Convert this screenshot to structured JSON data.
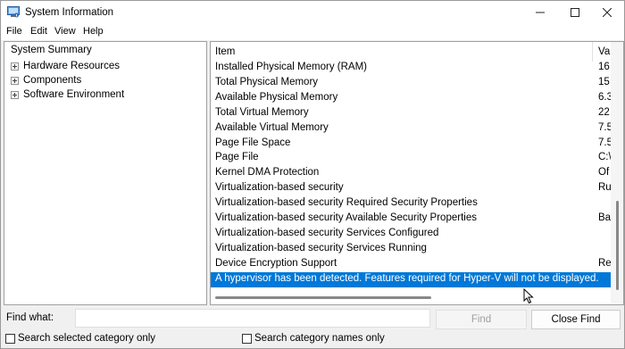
{
  "window": {
    "title": "System Information",
    "icon": "system-information-icon"
  },
  "menu": [
    "File",
    "Edit",
    "View",
    "Help"
  ],
  "tree": {
    "root": "System Summary",
    "children": [
      "Hardware Resources",
      "Components",
      "Software Environment"
    ]
  },
  "table": {
    "columns": {
      "item": "Item",
      "value": "Va"
    },
    "rows": [
      {
        "item": "Installed Physical Memory (RAM)",
        "value": "16"
      },
      {
        "item": "Total Physical Memory",
        "value": "15"
      },
      {
        "item": "Available Physical Memory",
        "value": "6.3"
      },
      {
        "item": "Total Virtual Memory",
        "value": "22"
      },
      {
        "item": "Available Virtual Memory",
        "value": "7.5"
      },
      {
        "item": "Page File Space",
        "value": "7.5"
      },
      {
        "item": "Page File",
        "value": "C:\\"
      },
      {
        "item": "Kernel DMA Protection",
        "value": "Of"
      },
      {
        "item": "Virtualization-based security",
        "value": "Ru"
      },
      {
        "item": "Virtualization-based security Required Security Properties",
        "value": ""
      },
      {
        "item": "Virtualization-based security Available Security Properties",
        "value": "Ba"
      },
      {
        "item": "Virtualization-based security Services Configured",
        "value": ""
      },
      {
        "item": "Virtualization-based security Services Running",
        "value": ""
      },
      {
        "item": "Device Encryption Support",
        "value": "Re"
      },
      {
        "item": "A hypervisor has been detected. Features required for Hyper-V will not be displayed.",
        "value": ""
      }
    ],
    "selected_index": 14
  },
  "find": {
    "label": "Find what:",
    "value": "",
    "find_button": "Find",
    "close_button": "Close Find",
    "search_selected": "Search selected category only",
    "search_names": "Search category names only"
  },
  "colors": {
    "selection": "#0078d7"
  }
}
